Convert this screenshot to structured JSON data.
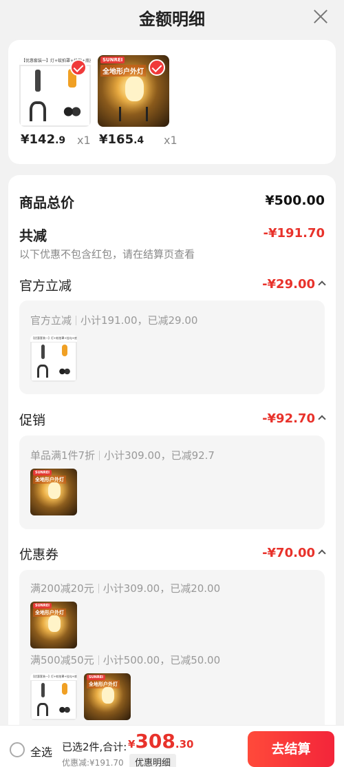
{
  "header": {
    "title": "金额明细"
  },
  "products": [
    {
      "price_int": "¥142",
      "price_dec": ".9",
      "qty": "x1",
      "banner": "【优惠套装一】灯+蚊拍罩+挂勾+底座"
    },
    {
      "price_int": "¥165",
      "price_dec": ".4",
      "qty": "x1",
      "brand": "SUNREI",
      "tag": "全地形户外灯"
    }
  ],
  "summary": {
    "total_label": "商品总价",
    "total_amount": "¥500.00",
    "reduce_label": "共减",
    "reduce_amount": "-¥191.70",
    "note": "以下优惠不包含红包，请在结算页查看",
    "sections": [
      {
        "title": "官方立减",
        "amount": "-¥29.00",
        "lines": [
          {
            "rule": "官方立减",
            "detail": "小计191.00，已减29.00"
          }
        ]
      },
      {
        "title": "促销",
        "amount": "-¥92.70",
        "lines": [
          {
            "rule": "单品满1件7折",
            "detail": "小计309.00，已减92.7"
          }
        ]
      },
      {
        "title": "优惠券",
        "amount": "-¥70.00",
        "lines": [
          {
            "rule": "满200减20元",
            "detail": "小计309.00，已减20.00"
          },
          {
            "rule": "满500减50元",
            "detail": "小计500.00，已减50.00"
          }
        ]
      }
    ]
  },
  "footer": {
    "select_all": "全选",
    "selected_text": "已选2件,合计:",
    "currency": "¥",
    "total_int": "308",
    "total_dec": ".30",
    "discount_text": "优惠减:¥191.70",
    "detail_chip": "优惠明细",
    "checkout": "去结算"
  },
  "colors": {
    "accent": "#e8322b",
    "button": "#f3253a"
  }
}
